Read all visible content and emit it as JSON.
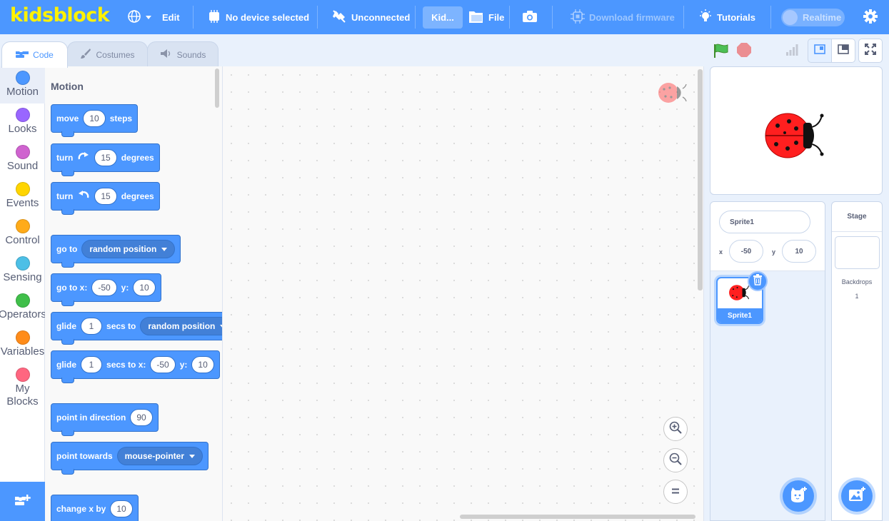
{
  "menubar": {
    "logo": "kidsblock",
    "edit": "Edit",
    "device": "No device selected",
    "connection": "Unconnected",
    "kid_button": "Kid...",
    "file": "File",
    "download_firmware": "Download firmware",
    "tutorials": "Tutorials",
    "realtime": "Realtime"
  },
  "tabs": {
    "code": "Code",
    "costumes": "Costumes",
    "sounds": "Sounds"
  },
  "categories": [
    {
      "label": "Motion",
      "color": "#4c97ff"
    },
    {
      "label": "Looks",
      "color": "#9966ff"
    },
    {
      "label": "Sound",
      "color": "#cf63cf"
    },
    {
      "label": "Events",
      "color": "#ffd500"
    },
    {
      "label": "Control",
      "color": "#ffab19"
    },
    {
      "label": "Sensing",
      "color": "#4cbfe6"
    },
    {
      "label": "Operators",
      "color": "#40bf4a"
    },
    {
      "label": "Variables",
      "color": "#ff8c1a"
    },
    {
      "label": "My Blocks",
      "color": "#ff6680"
    }
  ],
  "flyout": {
    "title": "Motion",
    "move": {
      "a": "move",
      "n": "10",
      "b": "steps"
    },
    "turn_right": {
      "a": "turn",
      "n": "15",
      "b": "degrees"
    },
    "turn_left": {
      "a": "turn",
      "n": "15",
      "b": "degrees"
    },
    "goto": {
      "a": "go to",
      "menu": "random position"
    },
    "gotoxy": {
      "a": "go to x:",
      "x": "-50",
      "y_label": "y:",
      "y": "10"
    },
    "glide": {
      "a": "glide",
      "n": "1",
      "b": "secs to",
      "menu": "random position"
    },
    "glidexy": {
      "a": "glide",
      "n": "1",
      "b": "secs to x:",
      "x": "-50",
      "y_label": "y:",
      "y": "10"
    },
    "point_dir": {
      "a": "point in direction",
      "n": "90"
    },
    "point_towards": {
      "a": "point towards",
      "menu": "mouse-pointer"
    },
    "change_x": {
      "a": "change x by",
      "n": "10"
    }
  },
  "sprite_info": {
    "name": "Sprite1",
    "x_label": "x",
    "x": "-50",
    "y_label": "y",
    "y": "10"
  },
  "sprite_list": [
    {
      "name": "Sprite1"
    }
  ],
  "stage_pane": {
    "title": "Stage",
    "backdrops_label": "Backdrops",
    "backdrops_count": "1"
  },
  "colors": {
    "accent": "#4c97ff",
    "logo": "#fff200",
    "ladybug_red": "#ff1f1f"
  }
}
